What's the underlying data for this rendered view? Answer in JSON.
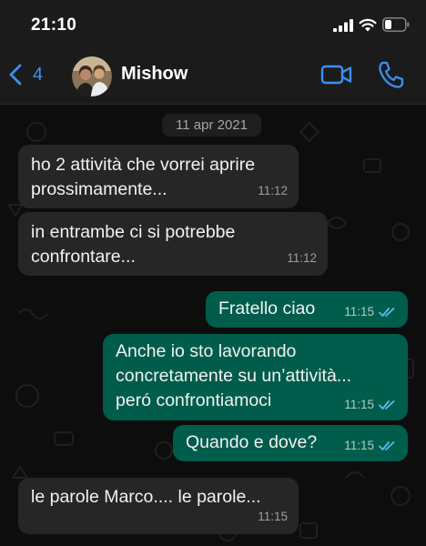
{
  "status_bar": {
    "time": "21:10"
  },
  "header": {
    "back_count": "4",
    "contact_name": "Mishow"
  },
  "chat": {
    "date_label": "11 apr 2021",
    "messages": [
      {
        "direction": "in",
        "lines": [
          "ho 2 attività che vorrei aprire",
          "prossimamente..."
        ],
        "time": "11:12"
      },
      {
        "direction": "in",
        "lines": [
          "in entrambe ci si potrebbe",
          "confrontare..."
        ],
        "time": "11:12"
      },
      {
        "direction": "out",
        "lines": [
          "Fratello ciao"
        ],
        "time": "11:15",
        "status": "read"
      },
      {
        "direction": "out",
        "lines": [
          "Anche io sto lavorando",
          "concretamente su un’attività...",
          "peró confrontiamoci"
        ],
        "time": "11:15",
        "status": "read"
      },
      {
        "direction": "out",
        "lines": [
          "Quando e dove?"
        ],
        "time": "11:15",
        "status": "read"
      },
      {
        "direction": "in",
        "lines": [
          "le parole Marco.... le parole..."
        ],
        "time": "11:15"
      }
    ]
  },
  "colors": {
    "accent": "#3b8ff0",
    "incoming_bubble": "#262626",
    "outgoing_bubble": "#005c4b",
    "read_ticks": "#53bdeb"
  }
}
